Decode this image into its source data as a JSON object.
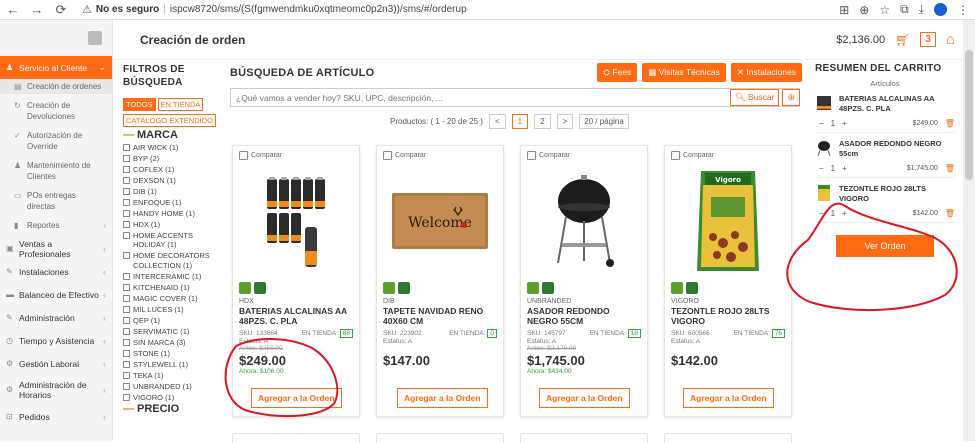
{
  "browser": {
    "insecure_label": "No es seguro",
    "url": "ispcw8720/sms/(S(fgmwendmku0xqtmeomc0p2n3))/sms/#/orderup"
  },
  "header": {
    "title": "Creación de orden",
    "total": "$2,136.00",
    "cart_count": "3"
  },
  "sidebar": {
    "items": [
      {
        "label": "Servicio al Cliente",
        "active": true
      },
      {
        "label": "Ventas a Profesionales"
      },
      {
        "label": "Instalaciones"
      },
      {
        "label": "Balanceo de Efectivo"
      },
      {
        "label": "Administración"
      },
      {
        "label": "Tiempo y Asistencia"
      },
      {
        "label": "Gestión Laboral"
      },
      {
        "label": "Administración de Horarios"
      },
      {
        "label": "Pedidos"
      }
    ],
    "subitems": [
      {
        "label": "Creación de ordenes"
      },
      {
        "label": "Creación de Devoluciones"
      },
      {
        "label": "Autorización de Override"
      },
      {
        "label": "Mantenimiento de Clientes"
      },
      {
        "label": "POs entregas directas"
      },
      {
        "label": "Reportes"
      }
    ]
  },
  "filters": {
    "title": "FILTROS DE BÚSQUEDA",
    "tab_all": "TODOS",
    "tab_store": "EN TIENDA",
    "tab_extended": "CATÁLOGO EXTENDIDO",
    "brand_section": "MARCA",
    "brands": [
      "AIR WICK (1)",
      "BYP (2)",
      "COFLEX (1)",
      "DEXSON (1)",
      "DIB (1)",
      "ENFOQUE (1)",
      "HANDY HOME (1)",
      "HDX (1)",
      "HOME ACCENTS HOLIDAY (1)",
      "HOME DECORATORS COLLECTION (1)",
      "INTERCERAMIC (1)",
      "KITCHENAID (1)",
      "MAGIC COVER (1)",
      "MIL LUCES (1)",
      "QEP (1)",
      "SERVIMATIC (1)",
      "SIN MARCA (3)",
      "STONE (1)",
      "STYLEWELL (1)",
      "TEKA (1)",
      "UNBRANDED (1)",
      "VIGORO (1)"
    ],
    "price_section": "PRECIO"
  },
  "main": {
    "title": "BÚSQUEDA DE ARTÍCULO",
    "btn_fees": "Fees",
    "btn_visits": "Visitas Técnicas",
    "btn_install": "Instalaciones",
    "search_placeholder": "¿Qué vamos a vender hoy? SKU, UPC, descripción, ...",
    "search_button": "Buscar",
    "products_label": "Productos: ( 1 - 20 de 25 )",
    "page_prev": "<",
    "page_1": "1",
    "page_2": "2",
    "page_next": ">",
    "per_page": "20 / página"
  },
  "products": [
    {
      "compare": "Comparar",
      "brand": "HDX",
      "name": "BATERIAS ALCALINAS AA 48PZS. C. PLA",
      "sku": "SKU: 133664",
      "store_label": "EN TIENDA:",
      "stock": "88",
      "status": "Estatus: A",
      "before": "Antes: $355.00",
      "price": "$249.00",
      "now": "Ahora: $106.00",
      "add": "Agregar a la Orden"
    },
    {
      "compare": "Comparar",
      "brand": "DIB",
      "name": "TAPETE NAVIDAD RENO 40X60 CM",
      "sku": "SKU: 223902",
      "store_label": "EN TIENDA:",
      "stock": "0",
      "status": "Estatus: A",
      "before": "",
      "price": "$147.00",
      "now": "",
      "add": "Agregar a la Orden"
    },
    {
      "compare": "Comparar",
      "brand": "UNBRANDED",
      "name": "ASADOR REDONDO NEGRO 55CM",
      "sku": "SKU: 145797",
      "store_label": "EN TIENDA:",
      "stock": "18",
      "status": "Estatus: A",
      "before": "Antes: $2,179.00",
      "price": "$1,745.00",
      "now": "Ahora: $434.00",
      "add": "Agregar a la Orden"
    },
    {
      "compare": "Comparar",
      "brand": "VIGORO",
      "name": "TEZONTLE ROJO 28LTS VIGORO",
      "sku": "SKU: 600566",
      "store_label": "EN TIENDA:",
      "stock": "76",
      "status": "Estatus: A",
      "before": "",
      "price": "$142.00",
      "now": "",
      "add": "Agregar a la Orden"
    }
  ],
  "summary": {
    "title": "RESUMEN DEL CARRITO",
    "subtitle": "Artículos",
    "items": [
      {
        "name": "BATERIAS ALCALINAS AA 48PZS. C. PLA",
        "qty": "1",
        "price": "$249.00"
      },
      {
        "name": "ASADOR REDONDO NEGRO 55cm",
        "qty": "1",
        "price": "$1,745.00"
      },
      {
        "name": "TEZONTLE ROJO 28LTS VIGORO",
        "qty": "1",
        "price": "$142.00"
      }
    ],
    "order_button": "Ver Orden"
  }
}
